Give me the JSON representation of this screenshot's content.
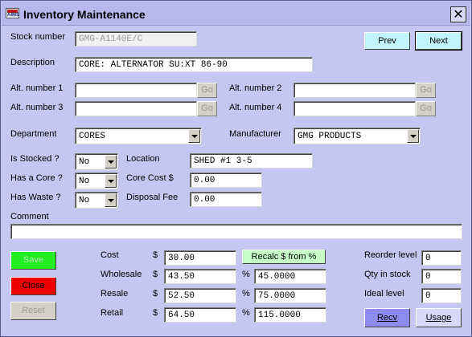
{
  "window": {
    "title": "Inventory Maintenance",
    "close_glyph": "✕",
    "app_icon_text": "AIMS",
    "colors": {
      "background": "#c6c6f2",
      "title_bar": "#b8b8ec"
    }
  },
  "nav": {
    "prev_label": "Prev",
    "next_label": "Next"
  },
  "stock_number": {
    "label": "Stock number",
    "value": "GMG-A1140E/C"
  },
  "description": {
    "label": "Description",
    "value": "CORE: ALTERNATOR SU:XT 86-90"
  },
  "alt_numbers": {
    "go_label": "Go",
    "items": [
      {
        "label": "Alt. number 1",
        "value": ""
      },
      {
        "label": "Alt. number 2",
        "value": ""
      },
      {
        "label": "Alt. number 3",
        "value": ""
      },
      {
        "label": "Alt. number 4",
        "value": ""
      }
    ]
  },
  "department": {
    "label": "Department",
    "value": "CORES"
  },
  "manufacturer": {
    "label": "Manufacturer",
    "value": "GMG PRODUCTS"
  },
  "is_stocked": {
    "label": "Is Stocked ?",
    "value": "No"
  },
  "has_core": {
    "label": "Has a Core ?",
    "value": "No"
  },
  "has_waste": {
    "label": "Has Waste ?",
    "value": "No"
  },
  "location": {
    "label": "Location",
    "value": "SHED #1 3-5"
  },
  "core_cost": {
    "label": "Core Cost $",
    "value": "0.00"
  },
  "disposal_fee": {
    "label": "Disposal Fee",
    "value": "0.00"
  },
  "comment": {
    "label": "Comment",
    "value": ""
  },
  "actions": {
    "save_label": "Save",
    "close_label": "Close",
    "reset_label": "Reset"
  },
  "pricing": {
    "dollar": "$",
    "percent": "%",
    "recalc_label": "Recalc $ from %",
    "cost": {
      "label": "Cost",
      "value": "30.00"
    },
    "wholesale": {
      "label": "Wholesale",
      "value": "43.50",
      "percent": "45.0000"
    },
    "resale": {
      "label": "Resale",
      "value": "52.50",
      "percent": "75.0000"
    },
    "retail": {
      "label": "Retail",
      "value": "64.50",
      "percent": "115.0000"
    }
  },
  "stock": {
    "reorder_level": {
      "label": "Reorder level",
      "value": "0"
    },
    "qty_in_stock": {
      "label": "Qty in stock",
      "value": "0"
    },
    "ideal_level": {
      "label": "Ideal level",
      "value": "0"
    }
  },
  "buttons": {
    "recv_label": "Recv",
    "usage_label": "Usage"
  }
}
